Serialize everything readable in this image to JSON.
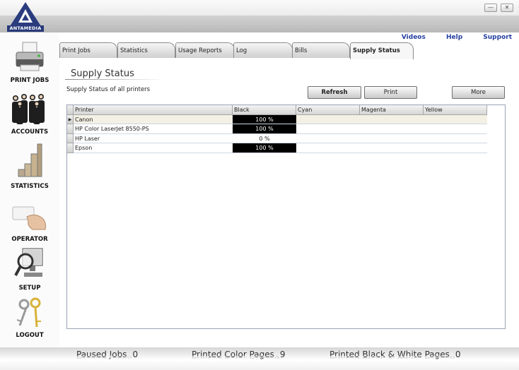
{
  "app": {
    "logo_text": "ANTAMEDIA",
    "minimize_glyph": "—",
    "close_glyph": "✕"
  },
  "toplinks": {
    "videos": "Videos",
    "help": "Help",
    "support": "Support"
  },
  "sidebar": {
    "items": [
      {
        "label": "PRINT JOBS",
        "icon": "printer-icon"
      },
      {
        "label": "ACCOUNTS",
        "icon": "people-icon"
      },
      {
        "label": "STATISTICS",
        "icon": "bar-chart-icon"
      },
      {
        "label": "OPERATOR",
        "icon": "card-hand-icon"
      },
      {
        "label": "SETUP",
        "icon": "magnifier-monitor-icon"
      },
      {
        "label": "LOGOUT",
        "icon": "keys-icon"
      }
    ]
  },
  "tabs": [
    {
      "label": "Print Jobs"
    },
    {
      "label": "Statistics"
    },
    {
      "label": "Usage Reports"
    },
    {
      "label": "Log"
    },
    {
      "label": "Bills"
    },
    {
      "label": "Supply Status",
      "active": true
    }
  ],
  "page": {
    "title": "Supply Status",
    "subtitle": "Supply Status of all printers",
    "buttons": {
      "refresh": "Refresh",
      "print": "Print",
      "more": "More"
    }
  },
  "table": {
    "columns": [
      "Printer",
      "Black",
      "Cyan",
      "Magenta",
      "Yellow"
    ],
    "rows": [
      {
        "printer": "Canon",
        "black": "100 %",
        "cyan": "",
        "magenta": "",
        "yellow": "",
        "black_level": 1.0
      },
      {
        "printer": "HP Color LaserJet 8550-PS",
        "black": "100 %",
        "cyan": "",
        "magenta": "",
        "yellow": "",
        "black_level": 1.0
      },
      {
        "printer": "HP Laser",
        "black": "0 %",
        "cyan": "",
        "magenta": "",
        "yellow": "",
        "black_level": 0.0
      },
      {
        "printer": "Epson",
        "black": "100 %",
        "cyan": "",
        "magenta": "",
        "yellow": "",
        "black_level": 1.0
      }
    ],
    "selected_row_marker": "▶"
  },
  "statusbar": {
    "paused_jobs_label": "Paused Jobs",
    "paused_jobs_value": "0",
    "color_pages_label": "Printed Color Pages",
    "color_pages_value": "9",
    "bw_pages_label": "Printed Black & White Pages",
    "bw_pages_value": "0"
  },
  "colors": {
    "accent": "#2640a0",
    "logo_blue": "#283a7a",
    "level_fill": "#000000",
    "selected_row": "#f3f0e4"
  }
}
